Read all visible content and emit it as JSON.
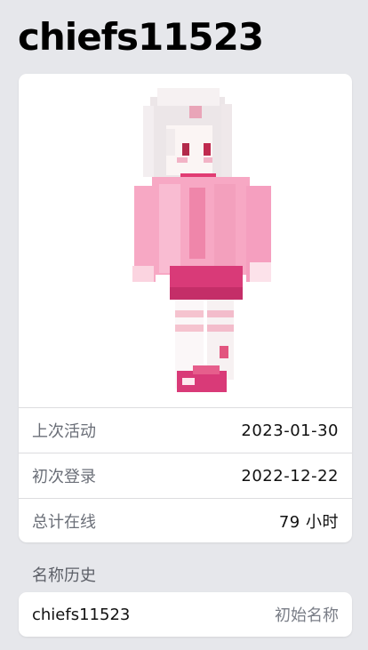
{
  "player": {
    "name": "chiefs11523"
  },
  "stats": [
    {
      "label": "上次活动",
      "value": "2023-01-30"
    },
    {
      "label": "初次登录",
      "value": "2022-12-22"
    },
    {
      "label": "总计在线",
      "value": "79 小时"
    }
  ],
  "name_history": {
    "title": "名称历史",
    "entries": [
      {
        "name": "chiefs11523",
        "tag": "初始名称"
      }
    ]
  },
  "colors": {
    "background": "#e6e7eb",
    "card": "#ffffff",
    "skin_pink": "#f7a8c4",
    "skin_magenta": "#d93a78",
    "skin_white": "#f4f0f1"
  }
}
